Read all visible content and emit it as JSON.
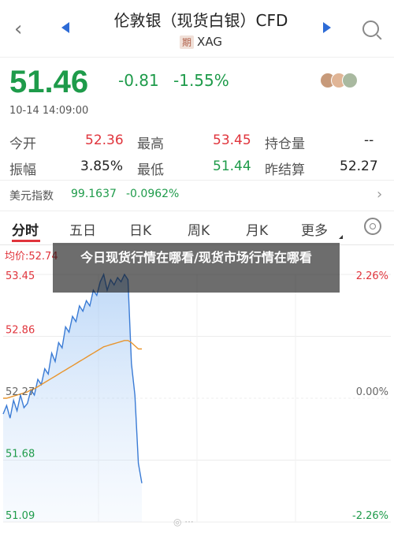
{
  "header": {
    "title": "伦敦银（现货白银）CFD",
    "badge": "期",
    "code": "XAG"
  },
  "quote": {
    "price": "51.46",
    "change": "-0.81",
    "change_pct": "-1.55%",
    "time": "10-14 14:09:00"
  },
  "stats": {
    "open_label": "今开",
    "open_value": "52.36",
    "high_label": "最高",
    "high_value": "53.45",
    "oi_label": "持仓量",
    "oi_value": "--",
    "amp_label": "振幅",
    "amp_value": "3.85%",
    "low_label": "最低",
    "low_value": "51.44",
    "prev_label": "昨结算",
    "prev_value": "52.27"
  },
  "usd_index": {
    "label": "美元指数",
    "value": "99.1637",
    "change": "-0.0962%"
  },
  "tabs": [
    "分时",
    "五日",
    "日K",
    "周K",
    "月K",
    "更多"
  ],
  "chart": {
    "avg_label": "均价:52.74",
    "left_ticks": [
      "53.45",
      "52.86",
      "52.27",
      "51.68",
      "51.09"
    ],
    "right_ticks": [
      "2.26%",
      "",
      "0.00%",
      "",
      "-2.26%"
    ]
  },
  "chart_data": {
    "type": "line",
    "ylim": [
      51.09,
      53.45
    ],
    "y_ticks_right": [
      "2.26%",
      "0.00%",
      "-2.26%"
    ],
    "series": [
      {
        "values": [
          52.12,
          52.2,
          52.08,
          52.25,
          52.15,
          52.3,
          52.18,
          52.22,
          52.35,
          52.3,
          52.45,
          52.4,
          52.55,
          52.5,
          52.7,
          52.62,
          52.8,
          52.75,
          52.95,
          52.9,
          53.05,
          53.0,
          53.15,
          53.1,
          53.2,
          53.15,
          53.3,
          53.25,
          53.38,
          53.45,
          53.3,
          53.4,
          53.35,
          53.42,
          53.38,
          53.45,
          53.4,
          52.6,
          52.3,
          51.65,
          51.46
        ]
      },
      {
        "name": "均价",
        "values": [
          52.27,
          52.27,
          52.28,
          52.29,
          52.3,
          52.31,
          52.32,
          52.33,
          52.35,
          52.36,
          52.38,
          52.4,
          52.42,
          52.44,
          52.46,
          52.48,
          52.5,
          52.52,
          52.54,
          52.56,
          52.58,
          52.6,
          52.62,
          52.64,
          52.66,
          52.68,
          52.7,
          52.72,
          52.74,
          52.76,
          52.77,
          52.78,
          52.79,
          52.8,
          52.81,
          52.82,
          52.82,
          52.8,
          52.77,
          52.74,
          52.74
        ]
      }
    ]
  },
  "news_overlay": "今日现货行情在哪看/现货市场行情在哪看",
  "colors": {
    "up": "#e0343c",
    "down": "#1e9b4a",
    "accent": "#2d6bd6",
    "avg_line": "#e8952e"
  }
}
